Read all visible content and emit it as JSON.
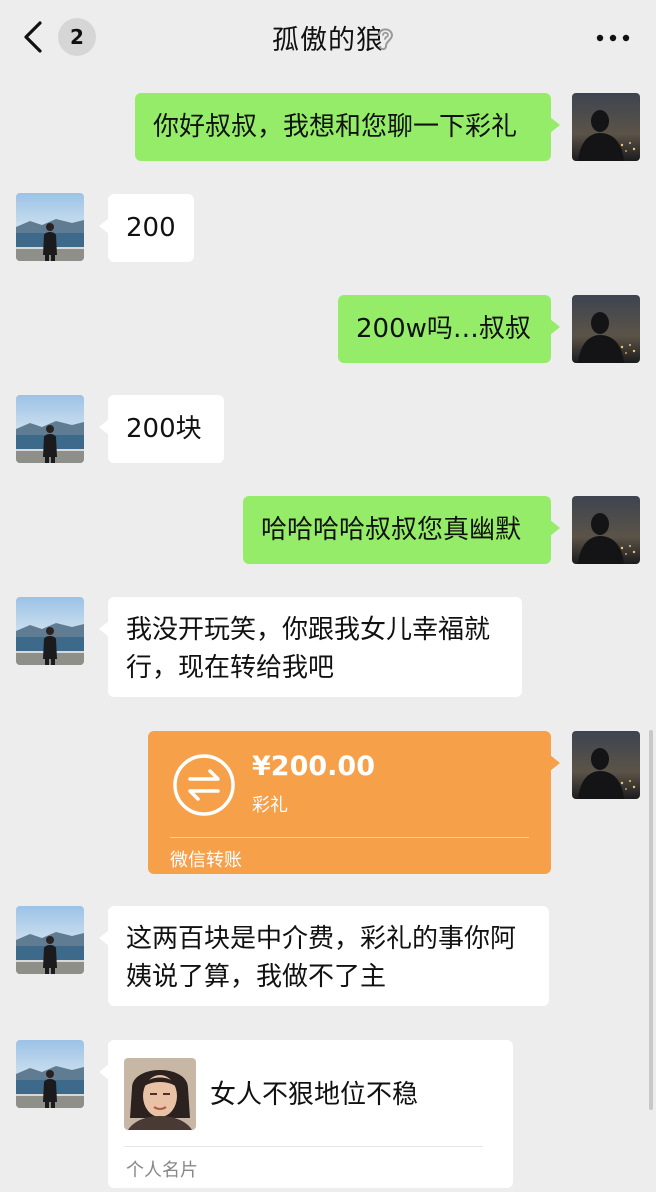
{
  "header": {
    "unread_count": "2",
    "title": "孤傲的狼",
    "icons": [
      "chevron-left-icon",
      "ear-icon",
      "more-icon"
    ]
  },
  "messages": [
    {
      "sender": "me",
      "text": "你好叔叔，我想和您聊一下彩礼"
    },
    {
      "sender": "them",
      "text": "200"
    },
    {
      "sender": "me",
      "text": "200w吗…叔叔"
    },
    {
      "sender": "them",
      "text": "200块"
    },
    {
      "sender": "me",
      "text": "哈哈哈哈叔叔您真幽默"
    },
    {
      "sender": "them",
      "text_line1": "我没开玩笑，你跟我女儿幸福就",
      "text_line2": "行，现在转给我吧"
    },
    {
      "sender": "me",
      "type": "transfer",
      "amount": "¥200.00",
      "note": "彩礼",
      "footer": "微信转账"
    },
    {
      "sender": "them",
      "text_line1": "这两百块是中介费，彩礼的事你阿",
      "text_line2": "姨说了算，我做不了主"
    },
    {
      "sender": "them",
      "type": "contact_card",
      "name": "女人不狠地位不稳",
      "label": "个人名片"
    }
  ],
  "colors": {
    "background": "#ededed",
    "my_bubble": "#95ec69",
    "their_bubble": "#ffffff",
    "transfer": "#f6a049"
  }
}
